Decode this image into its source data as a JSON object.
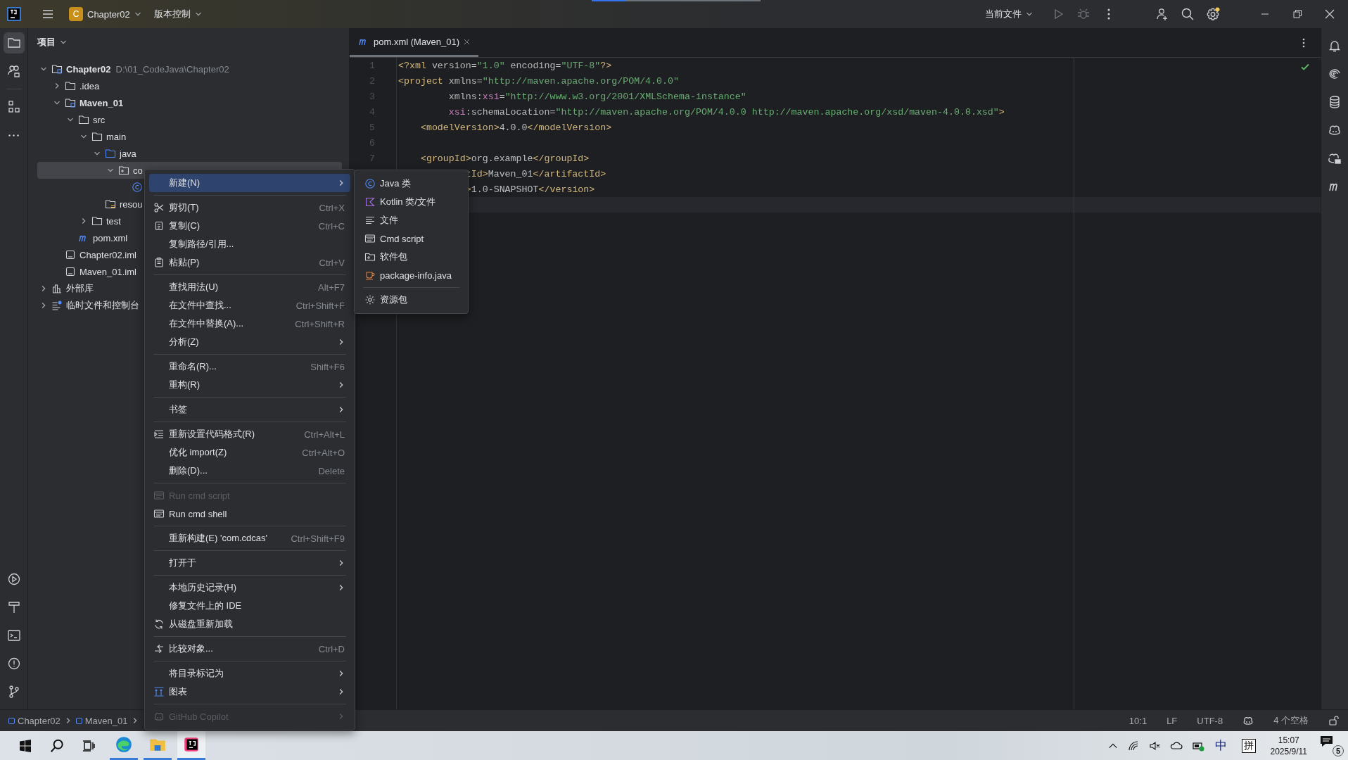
{
  "title_bar": {
    "project_badge": "C",
    "project": "Chapter02",
    "vcs": "版本控制",
    "run_config": "当前文件",
    "progress": {
      "level": 0.2
    },
    "settings_badge": true
  },
  "left_tools": [
    {
      "selected": true
    },
    {
      "selected": false
    },
    {
      "selected": false
    },
    {
      "selected": false
    }
  ],
  "project": {
    "title": "项目",
    "tree": [
      {
        "label": "Chapter02",
        "kind": "module",
        "path": "D:\\01_CodeJava\\Chapter02",
        "expanded": true,
        "selected": false,
        "children": [
          {
            "label": ".idea",
            "kind": "folder",
            "expanded": false,
            "selected": false
          },
          {
            "label": "Maven_01",
            "kind": "module",
            "expanded": true,
            "selected": false,
            "children": [
              {
                "label": "src",
                "kind": "folder",
                "expanded": true,
                "selected": false,
                "children": [
                  {
                    "label": "main",
                    "kind": "folder",
                    "expanded": true,
                    "selected": false,
                    "children": [
                      {
                        "label": "java",
                        "kind": "source",
                        "expanded": true,
                        "selected": false,
                        "children": [
                          {
                            "label": "co",
                            "kind": "package",
                            "expanded": true,
                            "selected": true,
                            "children": [
                              {
                                "kind": "class",
                                "selected": false
                              }
                            ]
                          }
                        ]
                      },
                      {
                        "label": "resou",
                        "kind": "resources",
                        "selected": false
                      }
                    ]
                  },
                  {
                    "label": "test",
                    "kind": "folder",
                    "expanded": false,
                    "selected": false
                  }
                ]
              },
              {
                "label": "pom.xml",
                "kind": "maven",
                "selected": false
              }
            ]
          },
          {
            "label": "Chapter02.iml",
            "kind": "iml",
            "selected": false
          },
          {
            "label": "Maven_01.iml",
            "kind": "iml",
            "selected": false
          }
        ]
      },
      {
        "label": "外部库",
        "kind": "library",
        "expanded": false,
        "selected": false
      },
      {
        "label": "临时文件和控制台",
        "kind": "scratch",
        "expanded": false,
        "selected": false
      }
    ]
  },
  "editor": {
    "tab": {
      "label": "pom.xml (Maven_01)",
      "selected": true
    },
    "inspection_ok": true,
    "lines": [
      {
        "number": "1",
        "current": false,
        "segments": [
          {
            "text": "<?xml",
            "kind": "tag"
          },
          {
            "text": " version=",
            "kind": "attr"
          },
          {
            "text": "\"1.0\"",
            "kind": "value"
          },
          {
            "text": " encoding=",
            "kind": "attr"
          },
          {
            "text": "\"UTF-8\"",
            "kind": "value"
          },
          {
            "text": "?>",
            "kind": "tag"
          }
        ]
      },
      {
        "number": "2",
        "current": false,
        "segments": [
          {
            "text": "<project",
            "kind": "tag"
          },
          {
            "text": " xmlns=",
            "kind": "attr"
          },
          {
            "text": "\"http://maven.apache.org/POM/4.0.0\"",
            "kind": "value"
          }
        ]
      },
      {
        "number": "3",
        "current": false,
        "segments": [
          {
            "text": "         xmlns:",
            "kind": "attr"
          },
          {
            "text": "xsi",
            "kind": "ns"
          },
          {
            "text": "=",
            "kind": "attr"
          },
          {
            "text": "\"http://www.w3.org/2001/XMLSchema-instance\"",
            "kind": "value"
          }
        ]
      },
      {
        "number": "4",
        "current": false,
        "segments": [
          {
            "text": "         xsi",
            "kind": "ns"
          },
          {
            "text": ":schemaLocation=",
            "kind": "attr"
          },
          {
            "text": "\"http://maven.apache.org/POM/4.0.0 http://maven.apache.org/xsd/maven-4.0.0.xsd\"",
            "kind": "value"
          },
          {
            "text": ">",
            "kind": "tag"
          }
        ]
      },
      {
        "number": "5",
        "current": false,
        "segments": [
          {
            "text": "    <modelVersion>",
            "kind": "tag"
          },
          {
            "text": "4.0.0",
            "kind": "text"
          },
          {
            "text": "</modelVersion>",
            "kind": "tag"
          }
        ]
      },
      {
        "number": "6",
        "current": false
      },
      {
        "number": "7",
        "current": false,
        "segments": [
          {
            "text": "    <groupId>",
            "kind": "tag"
          },
          {
            "text": "org.example",
            "kind": "text"
          },
          {
            "text": "</groupId>",
            "kind": "tag"
          }
        ]
      },
      {
        "current": false,
        "segments": [
          {
            "text": "            tId>",
            "kind": "tag"
          },
          {
            "text": "Maven_01",
            "kind": "text"
          },
          {
            "text": "</artifactId>",
            "kind": "tag"
          }
        ]
      },
      {
        "current": false,
        "segments": [
          {
            "text": "            >",
            "kind": "tag"
          },
          {
            "text": "1.0-SNAPSHOT",
            "kind": "text"
          },
          {
            "text": "</version>",
            "kind": "tag"
          }
        ]
      },
      {
        "current": true
      }
    ]
  },
  "context_menu": [
    {
      "kind": "item",
      "label": "新建(N)",
      "submenu": true,
      "disabled": false,
      "selected": true
    },
    {
      "kind": "separator"
    },
    {
      "kind": "item",
      "label": "剪切(T)",
      "shortcut": "Ctrl+X",
      "submenu": false,
      "disabled": false,
      "selected": false
    },
    {
      "kind": "item",
      "label": "复制(C)",
      "shortcut": "Ctrl+C",
      "submenu": false,
      "disabled": false,
      "selected": false
    },
    {
      "kind": "item",
      "label": "复制路径/引用...",
      "submenu": false,
      "disabled": false,
      "selected": false
    },
    {
      "kind": "item",
      "label": "粘贴(P)",
      "shortcut": "Ctrl+V",
      "submenu": false,
      "disabled": false,
      "selected": false
    },
    {
      "kind": "separator"
    },
    {
      "kind": "item",
      "label": "查找用法(U)",
      "shortcut": "Alt+F7",
      "submenu": false,
      "disabled": false,
      "selected": false
    },
    {
      "kind": "item",
      "label": "在文件中查找...",
      "shortcut": "Ctrl+Shift+F",
      "submenu": false,
      "disabled": false,
      "selected": false
    },
    {
      "kind": "item",
      "label": "在文件中替换(A)...",
      "shortcut": "Ctrl+Shift+R",
      "submenu": false,
      "disabled": false,
      "selected": false
    },
    {
      "kind": "item",
      "label": "分析(Z)",
      "submenu": true,
      "disabled": false,
      "selected": false
    },
    {
      "kind": "separator"
    },
    {
      "kind": "item",
      "label": "重命名(R)...",
      "shortcut": "Shift+F6",
      "submenu": false,
      "disabled": false,
      "selected": false
    },
    {
      "kind": "item",
      "label": "重构(R)",
      "submenu": true,
      "disabled": false,
      "selected": false
    },
    {
      "kind": "separator"
    },
    {
      "kind": "item",
      "label": "书签",
      "submenu": true,
      "disabled": false,
      "selected": false
    },
    {
      "kind": "separator"
    },
    {
      "kind": "item",
      "label": "重新设置代码格式(R)",
      "shortcut": "Ctrl+Alt+L",
      "submenu": false,
      "disabled": false,
      "selected": false
    },
    {
      "kind": "item",
      "label": "优化 import(Z)",
      "shortcut": "Ctrl+Alt+O",
      "submenu": false,
      "disabled": false,
      "selected": false
    },
    {
      "kind": "item",
      "label": "删除(D)...",
      "shortcut": "Delete",
      "submenu": false,
      "disabled": false,
      "selected": false
    },
    {
      "kind": "separator"
    },
    {
      "kind": "item",
      "label": "Run cmd script",
      "submenu": false,
      "disabled": true,
      "selected": false
    },
    {
      "kind": "item",
      "label": "Run cmd shell",
      "submenu": false,
      "disabled": false,
      "selected": false
    },
    {
      "kind": "separator"
    },
    {
      "kind": "item",
      "label": "重新构建(E) 'com.cdcas'",
      "shortcut": "Ctrl+Shift+F9",
      "submenu": false,
      "disabled": false,
      "selected": false
    },
    {
      "kind": "separator"
    },
    {
      "kind": "item",
      "label": "打开于",
      "submenu": true,
      "disabled": false,
      "selected": false
    },
    {
      "kind": "separator"
    },
    {
      "kind": "item",
      "label": "本地历史记录(H)",
      "submenu": true,
      "disabled": false,
      "selected": false
    },
    {
      "kind": "item",
      "label": "修复文件上的 IDE",
      "submenu": false,
      "disabled": false,
      "selected": false
    },
    {
      "kind": "item",
      "label": "从磁盘重新加载",
      "submenu": false,
      "disabled": false,
      "selected": false
    },
    {
      "kind": "separator"
    },
    {
      "kind": "item",
      "label": "比较对象...",
      "shortcut": "Ctrl+D",
      "submenu": false,
      "disabled": false,
      "selected": false
    },
    {
      "kind": "separator"
    },
    {
      "kind": "item",
      "label": "将目录标记为",
      "submenu": true,
      "disabled": false,
      "selected": false
    },
    {
      "kind": "item",
      "label": "图表",
      "submenu": true,
      "disabled": false,
      "selected": false
    },
    {
      "kind": "separator"
    },
    {
      "kind": "item",
      "label": "GitHub Copilot",
      "submenu": true,
      "disabled": true,
      "selected": false
    }
  ],
  "submenu": [
    {
      "kind": "item",
      "label": "Java 类"
    },
    {
      "kind": "item",
      "label": "Kotlin 类/文件"
    },
    {
      "kind": "item",
      "label": "文件"
    },
    {
      "kind": "item",
      "label": "Cmd script"
    },
    {
      "kind": "item",
      "label": "软件包"
    },
    {
      "kind": "item",
      "label": "package-info.java"
    },
    {
      "kind": "separator"
    },
    {
      "kind": "item",
      "label": "资源包"
    }
  ],
  "status_bar": {
    "breadcrumbs": [
      "Chapter02",
      "Maven_01"
    ],
    "position": "10:1",
    "line_separator": "LF",
    "encoding": "UTF-8",
    "indent": "4 个空格",
    "read_only": false
  },
  "taskbar": {
    "apps": [
      {
        "selected": false
      },
      {
        "selected": false
      },
      {
        "selected": true
      }
    ],
    "ime_mode": "中",
    "ime": "拼",
    "time": "15:07",
    "date": "2025/9/11",
    "notifications": "5"
  }
}
